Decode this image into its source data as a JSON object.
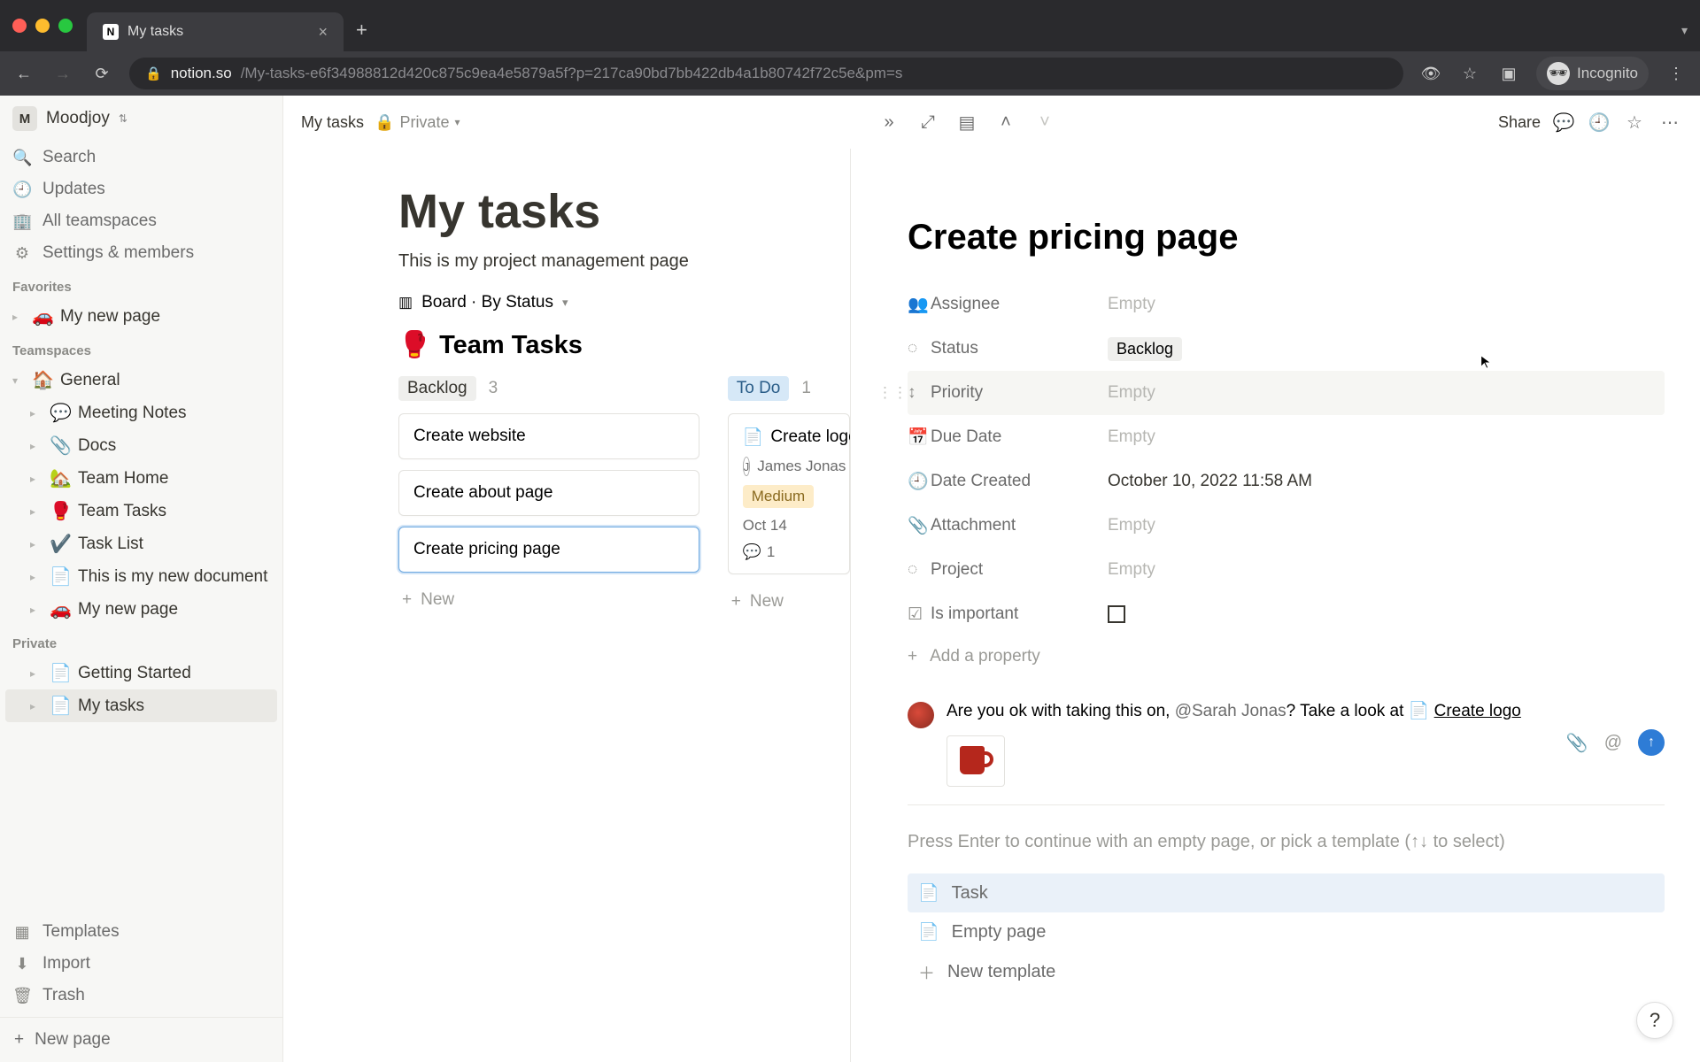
{
  "browser": {
    "tab_title": "My tasks",
    "url_domain": "notion.so",
    "url_path": "/My-tasks-e6f34988812d420c875c9ea4e5879a5f?p=217ca90bd7bb422db4a1b80742f72c5e&pm=s",
    "incognito_label": "Incognito"
  },
  "workspace": {
    "initial": "M",
    "name": "Moodjoy"
  },
  "sidebar": {
    "search": "Search",
    "updates": "Updates",
    "all_teamspaces": "All teamspaces",
    "settings": "Settings & members",
    "favorites_label": "Favorites",
    "favorites": [
      {
        "emoji": "🚗",
        "label": "My new page"
      }
    ],
    "teamspaces_label": "Teamspaces",
    "general": {
      "emoji": "🏠",
      "label": "General"
    },
    "teamspace_pages": [
      {
        "emoji": "💬",
        "label": "Meeting Notes"
      },
      {
        "emoji": "📎",
        "label": "Docs"
      },
      {
        "emoji": "🏡",
        "label": "Team Home"
      },
      {
        "emoji": "🥊",
        "label": "Team Tasks"
      },
      {
        "emoji": "✔️",
        "label": "Task List"
      },
      {
        "emoji": "📄",
        "label": "This is my new document"
      },
      {
        "emoji": "🚗",
        "label": "My new page"
      }
    ],
    "private_label": "Private",
    "private_pages": [
      {
        "emoji": "📄",
        "label": "Getting Started"
      },
      {
        "emoji": "📄",
        "label": "My tasks",
        "selected": true
      }
    ],
    "templates": "Templates",
    "import": "Import",
    "trash": "Trash",
    "new_page": "New page"
  },
  "topbar": {
    "breadcrumb": "My tasks",
    "private": "Private",
    "share": "Share"
  },
  "page": {
    "title": "My tasks",
    "subtitle": "This is my project management page",
    "view_label": "Board · By Status",
    "db_emoji": "🥊",
    "db_title": "Team Tasks",
    "columns": [
      {
        "status": "Backlog",
        "status_class": "status-backlog",
        "count": "3",
        "cards": [
          {
            "title": "Create website"
          },
          {
            "title": "Create about page"
          },
          {
            "title": "Create pricing page",
            "selected": true
          }
        ],
        "new": "New"
      },
      {
        "status": "To Do",
        "status_class": "status-todo",
        "count": "1",
        "cards": [
          {
            "title": "Create logo",
            "has_icon": true,
            "assignee_initial": "J",
            "assignee_name": "James Jonas",
            "priority": "Medium",
            "date": "Oct 14",
            "comments": "1"
          }
        ],
        "new": "New"
      }
    ]
  },
  "peek": {
    "title": "Create pricing page",
    "empty": "Empty",
    "properties": [
      {
        "icon": "👥",
        "name": "Assignee",
        "value": "",
        "empty": true
      },
      {
        "icon": "◌",
        "name": "Status",
        "value": "Backlog",
        "pill": true
      },
      {
        "icon": "↕",
        "name": "Priority",
        "value": "",
        "empty": true,
        "hover": true
      },
      {
        "icon": "📅",
        "name": "Due Date",
        "value": "",
        "empty": true
      },
      {
        "icon": "🕘",
        "name": "Date Created",
        "value": "October 10, 2022 11:58 AM"
      },
      {
        "icon": "📎",
        "name": "Attachment",
        "value": "",
        "empty": true
      },
      {
        "icon": "◌",
        "name": "Project",
        "value": "",
        "empty": true
      },
      {
        "icon": "☑",
        "name": "Is important",
        "checkbox": true
      }
    ],
    "add_property": "Add a property",
    "comment": {
      "text_before": "Are you ok with taking this on, ",
      "mention": "@Sarah Jonas",
      "text_mid": "? Take a look at ",
      "page_ref": "Create logo"
    },
    "template_hint": "Press Enter to continue with an empty page, or pick a template (↑↓ to select)",
    "templates": [
      {
        "icon": "📄",
        "label": "Task",
        "selected": true
      },
      {
        "icon": "📄",
        "label": "Empty page"
      },
      {
        "icon": "＋",
        "label": "New template"
      }
    ]
  },
  "help": "?"
}
